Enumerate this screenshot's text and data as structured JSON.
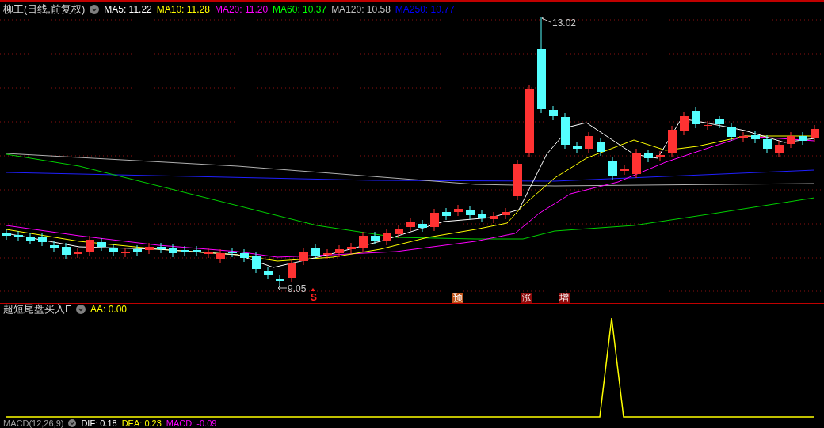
{
  "main_panel": {
    "title": "柳工(日线,前复权)",
    "legend": [
      {
        "text": "MA5: 11.22",
        "color": "#ffffff"
      },
      {
        "text": "MA10: 11.28",
        "color": "#ffff00"
      },
      {
        "text": "MA20: 11.20",
        "color": "#ff00ff"
      },
      {
        "text": "MA60: 10.37",
        "color": "#00ff00"
      },
      {
        "text": "MA120: 10.58",
        "color": "#c0c0c0"
      },
      {
        "text": "MA250: 10.77",
        "color": "#0000ff"
      }
    ],
    "high_label": "13.02",
    "low_label": "9.05",
    "markers": [
      {
        "text": "S",
        "kind": "signal",
        "color": "#ff2020"
      },
      {
        "text": "预",
        "kind": "badge",
        "color": "#c0561c"
      },
      {
        "text": "涨",
        "kind": "badge",
        "color": "#8c0a0a"
      },
      {
        "text": "增",
        "kind": "badge",
        "color": "#8c0a0a"
      }
    ]
  },
  "indicator_panel": {
    "title": "超短尾盘买入F",
    "legend": [
      {
        "text": "AA: 0.00",
        "color": "#ffff00"
      }
    ]
  },
  "macd_panel": {
    "title": "MACD(12,26,9)",
    "legend": [
      {
        "text": "DIF: 0.18",
        "color": "#ffffff"
      },
      {
        "text": "DEA: 0.23",
        "color": "#ffff00"
      },
      {
        "text": "MACD: -0.09",
        "color": "#ff00ff"
      }
    ]
  }
}
